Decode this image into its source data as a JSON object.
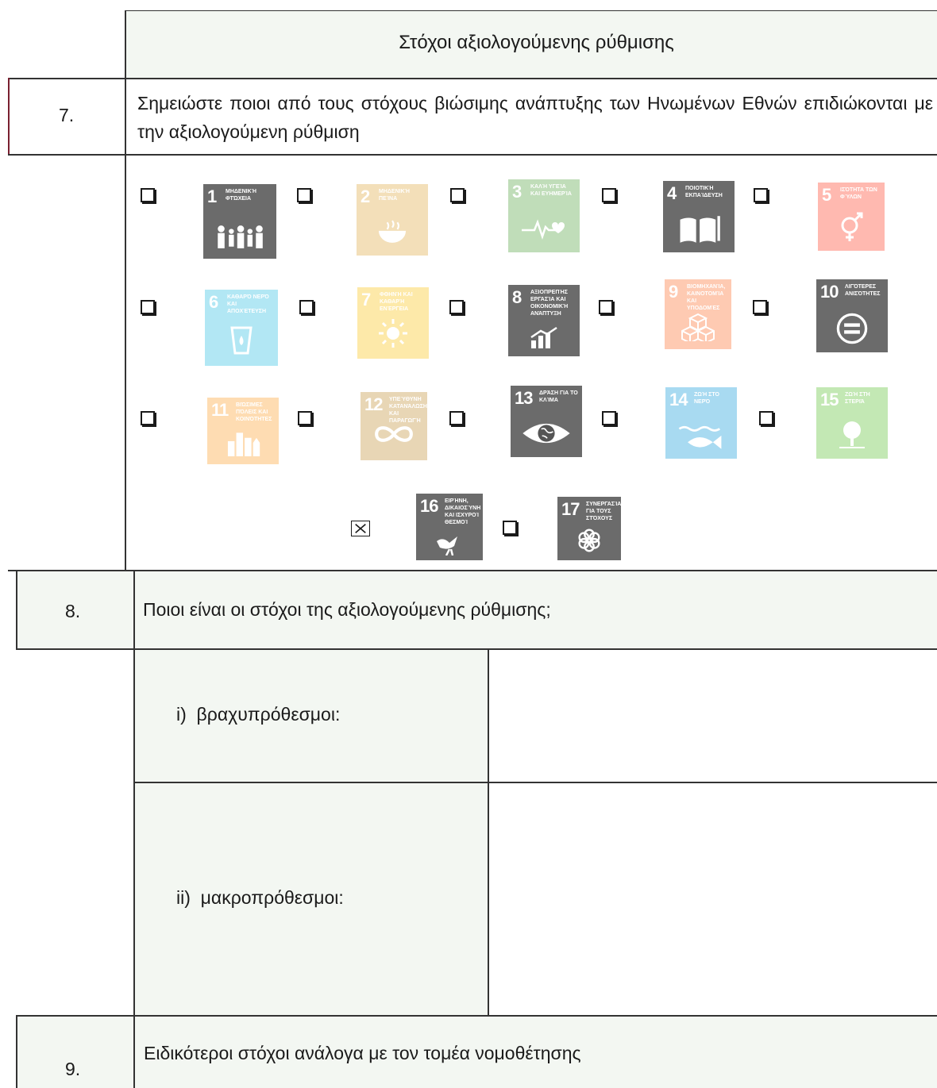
{
  "header": {
    "title": "Στόχοι αξιολογούμενης ρύθμισης"
  },
  "q7": {
    "number": "7.",
    "text": "Σημειώστε ποιοι από τους στόχους βιώσιμης ανάπτυξης των Ηνωμένων Εθνών επιδιώκονται με την αξιολογούμενη ρύθμιση"
  },
  "sdgs": [
    {
      "num": "1",
      "caption": "Μηδενική φτώχεια",
      "checked": false,
      "highlighted": true,
      "icon": "family-icon"
    },
    {
      "num": "2",
      "caption": "Μηδενική πείνα",
      "checked": false,
      "highlighted": false,
      "icon": "bowl-icon"
    },
    {
      "num": "3",
      "caption": "Καλή υγεία και ευημερία",
      "checked": false,
      "highlighted": false,
      "icon": "heartbeat-icon"
    },
    {
      "num": "4",
      "caption": "Ποιοτική εκπαίδευση",
      "checked": false,
      "highlighted": true,
      "icon": "book-icon"
    },
    {
      "num": "5",
      "caption": "Ισότητα των φύλων",
      "checked": false,
      "highlighted": false,
      "icon": "gender-icon"
    },
    {
      "num": "6",
      "caption": "Καθαρό νερό και αποχέτευση",
      "checked": false,
      "highlighted": false,
      "icon": "water-glass-icon"
    },
    {
      "num": "7",
      "caption": "Φθηνή και καθαρή ενέργεια",
      "checked": false,
      "highlighted": false,
      "icon": "sun-icon"
    },
    {
      "num": "8",
      "caption": "Αξιοπρεπής εργασία και οικονομική ανάπτυξη",
      "checked": false,
      "highlighted": true,
      "icon": "growth-chart-icon"
    },
    {
      "num": "9",
      "caption": "Βιομηχανία, καινοτομία και υποδομές",
      "checked": false,
      "highlighted": false,
      "icon": "cubes-icon"
    },
    {
      "num": "10",
      "caption": "Λιγότερες ανισότητες",
      "checked": false,
      "highlighted": true,
      "icon": "equal-icon"
    },
    {
      "num": "11",
      "caption": "Βιώσιμες πόλεις και κοινότητες",
      "checked": false,
      "highlighted": false,
      "icon": "buildings-icon"
    },
    {
      "num": "12",
      "caption": "Υπεύθυνη κατανάλωση και παραγωγή",
      "checked": false,
      "highlighted": false,
      "icon": "infinity-icon"
    },
    {
      "num": "13",
      "caption": "Δράση για το κλίμα",
      "checked": false,
      "highlighted": true,
      "icon": "earth-eye-icon"
    },
    {
      "num": "14",
      "caption": "Ζωή στο νερό",
      "checked": false,
      "highlighted": false,
      "icon": "fish-icon"
    },
    {
      "num": "15",
      "caption": "Ζωή στη στεριά",
      "checked": false,
      "highlighted": false,
      "icon": "tree-icon"
    },
    {
      "num": "16",
      "caption": "Ειρήνη, δικαιοσύνη και ισχυροί θεσμοί",
      "checked": true,
      "highlighted": true,
      "icon": "dove-icon"
    },
    {
      "num": "17",
      "caption": "Συνεργασία για τους στόχους",
      "checked": false,
      "highlighted": true,
      "icon": "flower-icon"
    }
  ],
  "q8": {
    "number": "8.",
    "text": "Ποιοι είναι οι στόχοι της αξιολογούμενης ρύθμισης;",
    "short_term_label": "i)  βραχυπρόθεσμοι:",
    "short_term_value": "",
    "long_term_label": "ii)  μακροπρόθεσμοι:",
    "long_term_value": ""
  },
  "q9": {
    "number": "9.",
    "text": "Ειδικότεροι στόχοι ανάλογα με τον τομέα νομοθέτησης"
  },
  "colors": {
    "tint": "#f3f7f2",
    "sdg_1": "#e5243b",
    "sdg_2": "#dda63a",
    "sdg_3": "#4c9f38",
    "sdg_4": "#c5192d",
    "sdg_5": "#ff3a21",
    "sdg_6": "#26bde2",
    "sdg_7": "#fcc30b",
    "sdg_8": "#a21942",
    "sdg_9": "#fd6925",
    "sdg_10": "#dd1367",
    "sdg_11": "#fd9d24",
    "sdg_12": "#bf8b2e",
    "sdg_13": "#3f7e44",
    "sdg_14": "#0a97d9",
    "sdg_15": "#56c02b",
    "sdg_16": "#00689d",
    "sdg_17": "#19486a"
  }
}
